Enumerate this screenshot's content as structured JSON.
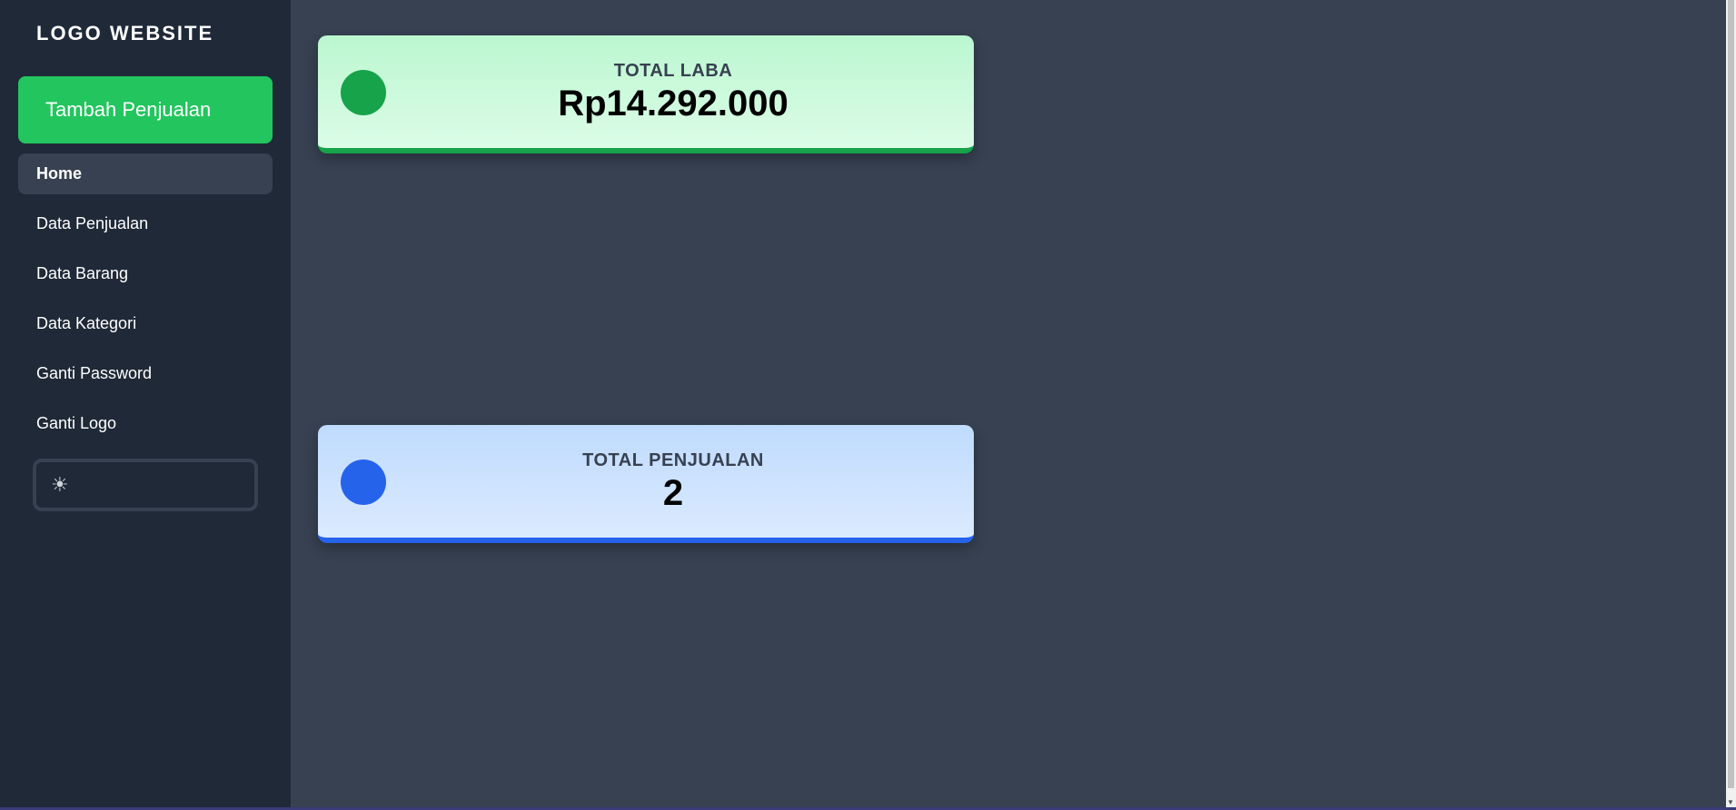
{
  "sidebar": {
    "logo": "LOGO WEBSITE",
    "add_button": "Tambah Penjualan",
    "items": [
      {
        "label": "Home",
        "active": true
      },
      {
        "label": "Data Penjualan",
        "active": false
      },
      {
        "label": "Data Barang",
        "active": false
      },
      {
        "label": "Data Kategori",
        "active": false
      },
      {
        "label": "Ganti Password",
        "active": false
      },
      {
        "label": "Ganti Logo",
        "active": false
      }
    ],
    "theme_toggle_icon": "sun-icon"
  },
  "cards": {
    "laba": {
      "label": "TOTAL LABA",
      "value": "Rp14.292.000",
      "color": "#16a34a"
    },
    "penjualan": {
      "label": "TOTAL PENJUALAN",
      "value": "2",
      "color": "#2563eb"
    }
  },
  "colors": {
    "sidebar_bg": "#1f2937",
    "main_bg": "#374151",
    "accent_green": "#22c55e"
  }
}
